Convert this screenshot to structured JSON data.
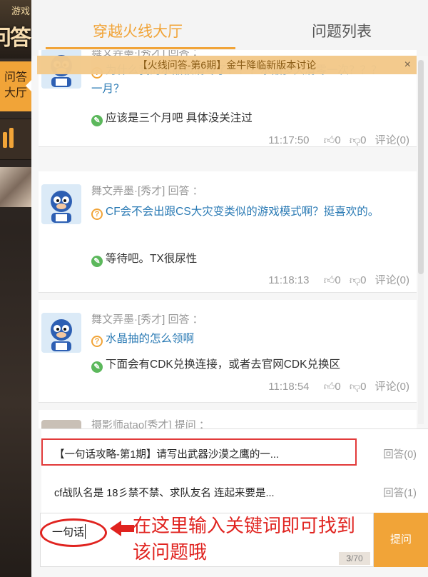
{
  "sidebar": {
    "logo_small": "游戏",
    "logo_big": "问答",
    "active_tab_line1": "问答",
    "active_tab_line2": "大厅"
  },
  "tabs": [
    {
      "label": "穿越火线大厅",
      "active": true
    },
    {
      "label": "问题列表",
      "active": false
    }
  ],
  "announcement": {
    "text": "【火线问答-第6期】金牛降临新版本讨论",
    "close": "×"
  },
  "posts": [
    {
      "user": "舞文弄墨·[秀才]  回答  ：",
      "question": "为什么我的水晶被清零了？？？水晶多久清零一次？？？一月？",
      "answer": "应该是三个月吧 具体没关注过",
      "time": "11:17:50",
      "likes": "0",
      "dislikes": "0",
      "comments": "评论(0)"
    },
    {
      "user": "舞文弄墨·[秀才]  回答  ：",
      "question": "CF会不会出跟CS大灾变类似的游戏模式啊？挺喜欢的。",
      "answer": "等待吧。TX很尿性",
      "time": "11:18:13",
      "likes": "0",
      "dislikes": "0",
      "comments": "评论(0)"
    },
    {
      "user": "舞文弄墨·[秀才]  回答  ：",
      "question": "水晶抽的怎么领啊",
      "answer": "下面会有CDK兑换连接，或者去官网CDK兑换区",
      "time": "11:18:54",
      "likes": "0",
      "dislikes": "0",
      "comments": "评论(0)"
    },
    {
      "user": "摄影师atao[秀才]  提问  ："
    }
  ],
  "suggestions": [
    {
      "text": "【一句话攻略-第1期】请写出武器沙漠之鹰的一...",
      "answers": "回答(0)"
    },
    {
      "text": "cf战队名是 18彡禁不禁、求队友名 连起来要是...",
      "answers": "回答(1)"
    }
  ],
  "input": {
    "value": "一句话",
    "count": "3",
    "max": "/70"
  },
  "submit_label": "提问",
  "annotation": {
    "text": "在这里输入关键词即可找到该问题哦"
  },
  "colors": {
    "accent": "#f1a438",
    "link": "#2a7ab4",
    "annotation": "#e0231f"
  }
}
